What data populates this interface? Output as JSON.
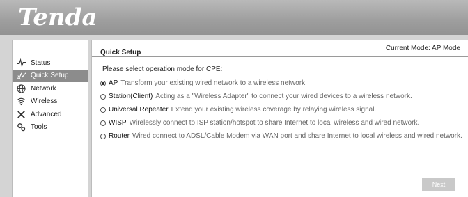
{
  "brand": {
    "logo_text": "Tenda"
  },
  "sidebar": {
    "items": [
      {
        "label": "Status",
        "icon": "pulse-icon",
        "active": false
      },
      {
        "label": "Quick Setup",
        "icon": "quick-setup-icon",
        "active": true
      },
      {
        "label": "Network",
        "icon": "globe-icon",
        "active": false
      },
      {
        "label": "Wireless",
        "icon": "wifi-icon",
        "active": false
      },
      {
        "label": "Advanced",
        "icon": "tools-cross-icon",
        "active": false
      },
      {
        "label": "Tools",
        "icon": "gears-icon",
        "active": false
      }
    ]
  },
  "main": {
    "title": "Quick Setup",
    "current_mode": "Current Mode: AP Mode",
    "prompt": "Please select operation mode for CPE:",
    "options": [
      {
        "name": "AP",
        "desc": "Transform your existing wired network to a wireless network.",
        "checked": true
      },
      {
        "name": "Station(Client)",
        "desc": "Acting as a \"Wireless Adapter\" to connect your wired devices to a wireless network.",
        "checked": false
      },
      {
        "name": "Universal Repeater",
        "desc": "Extend your existing wireless coverage by relaying wireless signal.",
        "checked": false
      },
      {
        "name": "WISP",
        "desc": "Wirelessly connect to ISP station/hotspot to share Internet to local wireless and wired network.",
        "checked": false
      },
      {
        "name": "Router",
        "desc": "Wired connect to ADSL/Cable Modem via WAN port and share Internet to local wireless and wired network.",
        "checked": false
      }
    ],
    "next_label": "Next"
  },
  "colors": {
    "active_nav": "#8c8c8c",
    "header_bg": "#a3a3a3",
    "disabled_button": "#c9c9c9"
  }
}
